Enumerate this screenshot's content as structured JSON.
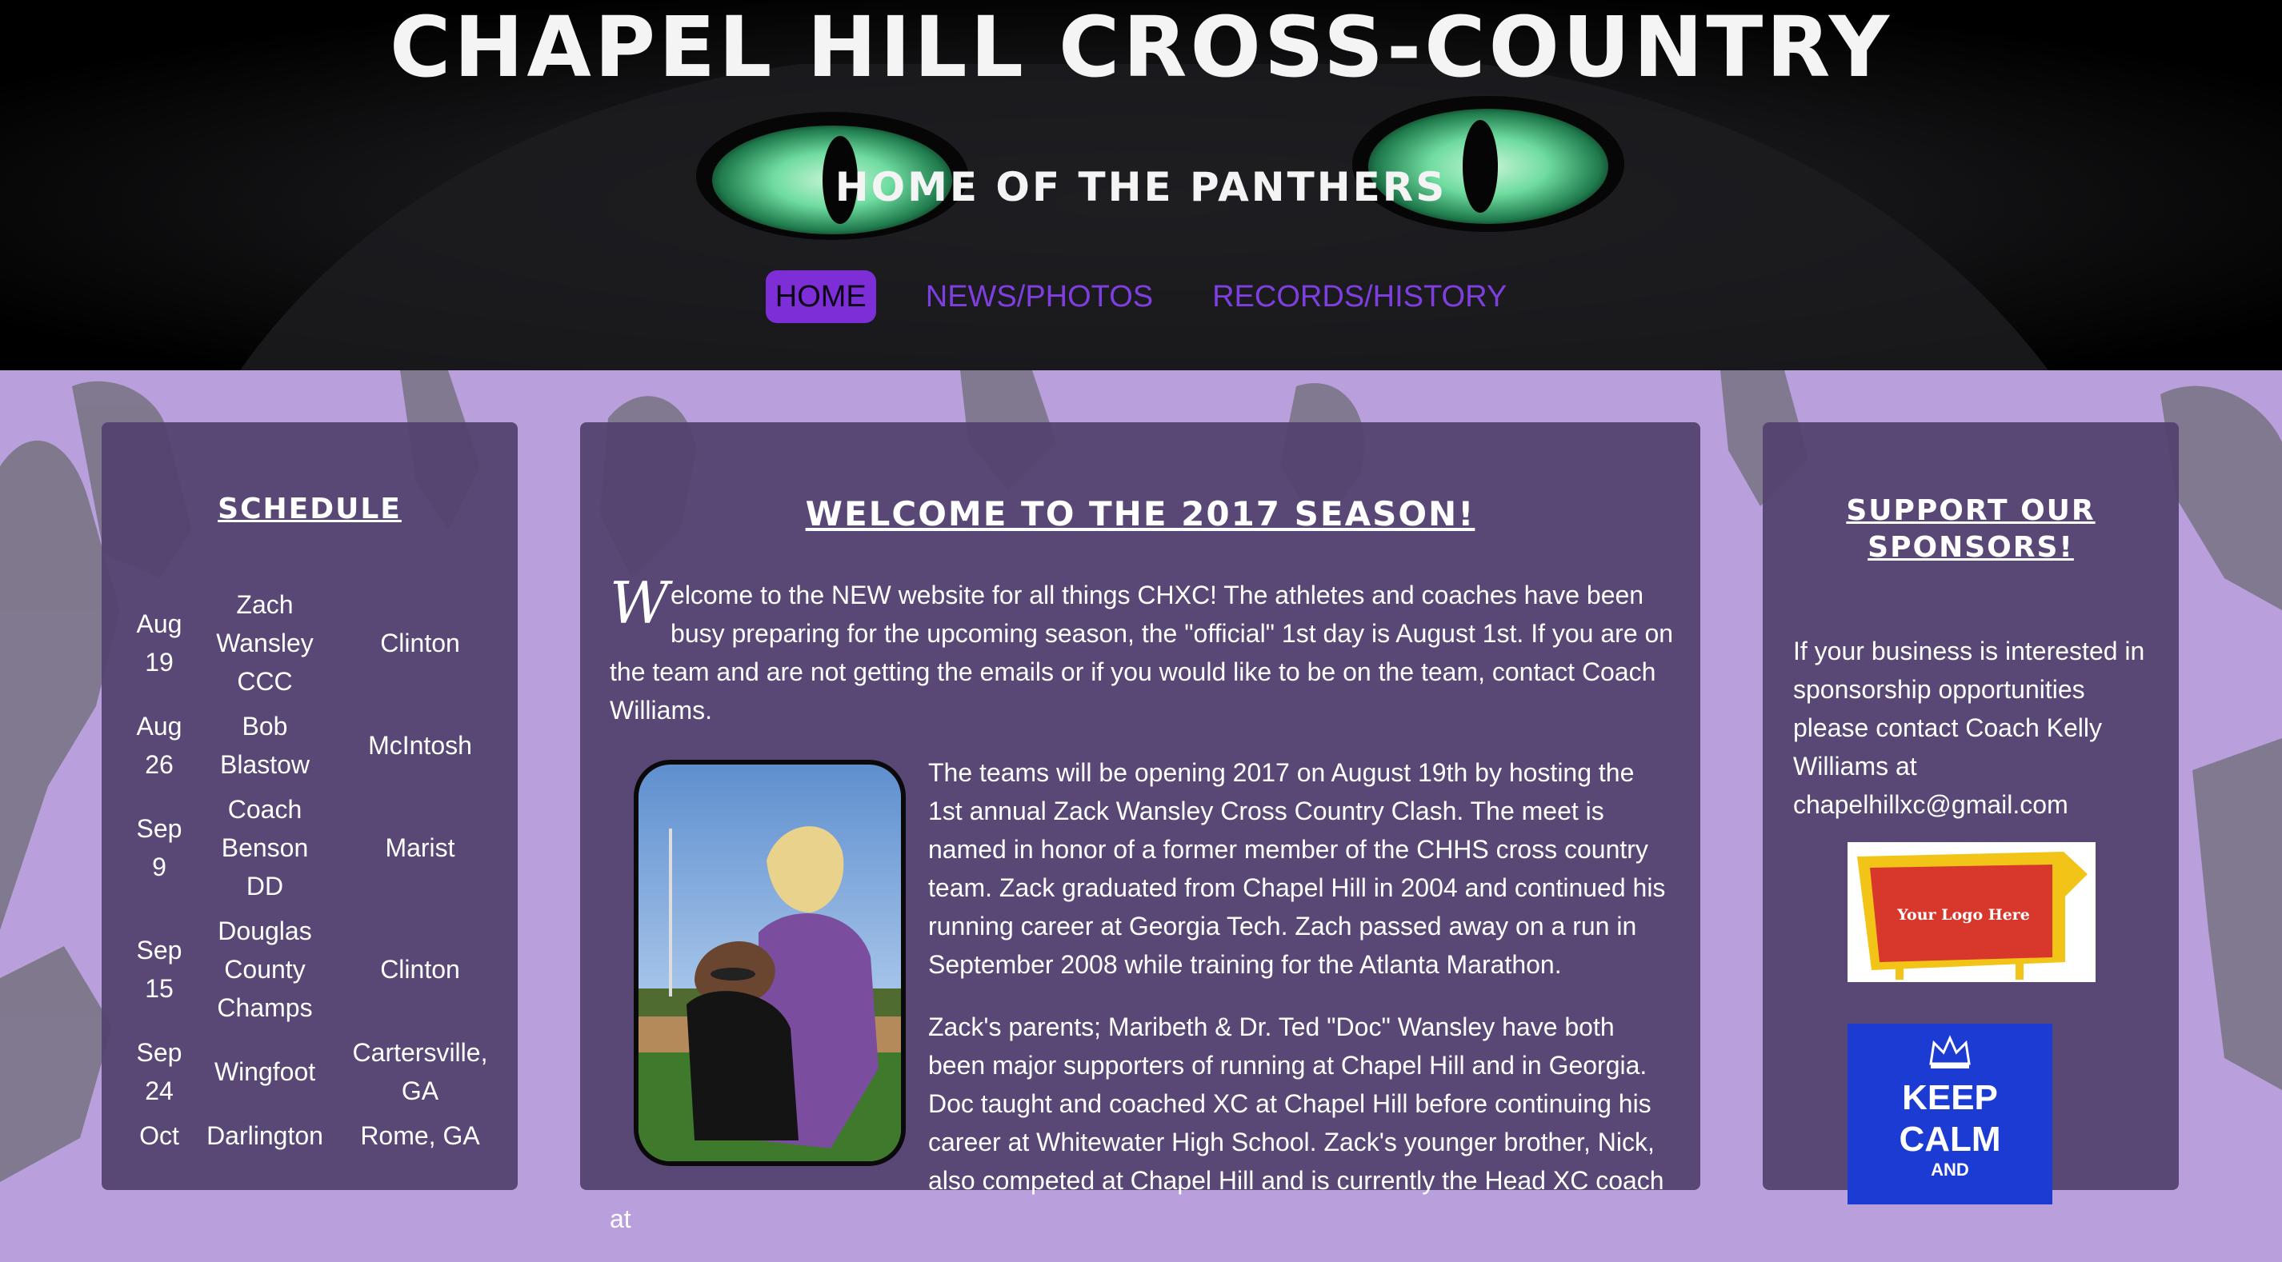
{
  "header": {
    "title": "CHAPEL HILL CROSS-COUNTRY",
    "subtitle": "HOME OF THE PANTHERS"
  },
  "nav": {
    "items": [
      {
        "label": "HOME",
        "active": true
      },
      {
        "label": "NEWS/PHOTOS",
        "active": false
      },
      {
        "label": "RECORDS/HISTORY",
        "active": false
      }
    ]
  },
  "schedule": {
    "heading": "SCHEDULE",
    "rows": [
      {
        "date": "Aug 19",
        "meet": "Zach Wansley CCC",
        "location": "Clinton"
      },
      {
        "date": "Aug 26",
        "meet": "Bob Blastow",
        "location": "McIntosh"
      },
      {
        "date": "Sep 9",
        "meet": "Coach Benson DD",
        "location": "Marist"
      },
      {
        "date": "Sep 15",
        "meet": "Douglas County Champs",
        "location": "Clinton"
      },
      {
        "date": "Sep 24",
        "meet": "Wingfoot",
        "location": "Cartersville, GA"
      },
      {
        "date": "Oct",
        "meet": "Darlington",
        "location": "Rome, GA"
      }
    ]
  },
  "main": {
    "heading": "WELCOME TO THE 2017 SEASON!",
    "intro_dropcap": "W",
    "intro_rest": "elcome to the NEW website for all things CHXC! The athletes and coaches have been busy preparing for the upcoming season, the \"official\" 1st day is August 1st. If you are on the team and are not getting the emails or if you would like to be on the team, contact Coach Williams.",
    "para2": "The teams will be opening 2017 on August 19th by hosting the 1st annual Zack Wansley Cross Country Clash. The meet is named in honor of a former member of the CHHS cross country team. Zack graduated from Chapel Hill in 2004 and continued his running career at Georgia Tech. Zach passed away on a run in September 2008 while training for the Atlanta Marathon.",
    "para3": "Zack's parents; Maribeth & Dr. Ted \"Doc\" Wansley have both been major supporters of running at Chapel Hill and in Georgia. Doc taught and coached XC at Chapel Hill before continuing his career at Whitewater High School. Zack's younger brother, Nick, also competed at Chapel Hill and is currently the Head XC coach at"
  },
  "sponsors": {
    "heading": "SUPPORT OUR SPONSORS!",
    "text": "If your business is interested in sponsorship opportunities please contact Coach Kelly Williams at chapelhillxc@gmail.com",
    "logo_placeholder": "Your Logo Here",
    "keep_calm_line1": "KEEP",
    "keep_calm_line2": "CALM",
    "keep_calm_line3": "AND"
  },
  "colors": {
    "accent": "#7d2ed6",
    "panel": "#52426e",
    "background": "#b9a0dc"
  }
}
